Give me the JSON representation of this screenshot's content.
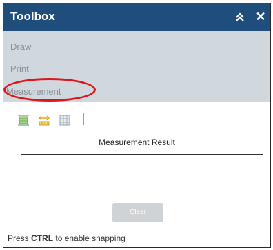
{
  "toolbox": {
    "title": "Toolbox",
    "collapse_icon": "double-chevron-up-icon",
    "close_label": "✕",
    "accent": "#1f4e7d",
    "nav": {
      "items": [
        {
          "label": "Draw"
        },
        {
          "label": "Print"
        },
        {
          "label": "Measurement"
        }
      ],
      "highlight_color": "#e0141c"
    },
    "measurement": {
      "tools": [
        {
          "icon": "area-measure-icon",
          "color": "#6aa84f"
        },
        {
          "icon": "distance-measure-icon",
          "color": "#e0a400"
        },
        {
          "icon": "location-icon",
          "color": "#8fa3b0"
        }
      ],
      "result_label": "Measurement Result",
      "clear_label": "Clear",
      "hint_prefix": "Press",
      "hint_key": "CTRL",
      "hint_suffix": "to enable snapping"
    }
  }
}
